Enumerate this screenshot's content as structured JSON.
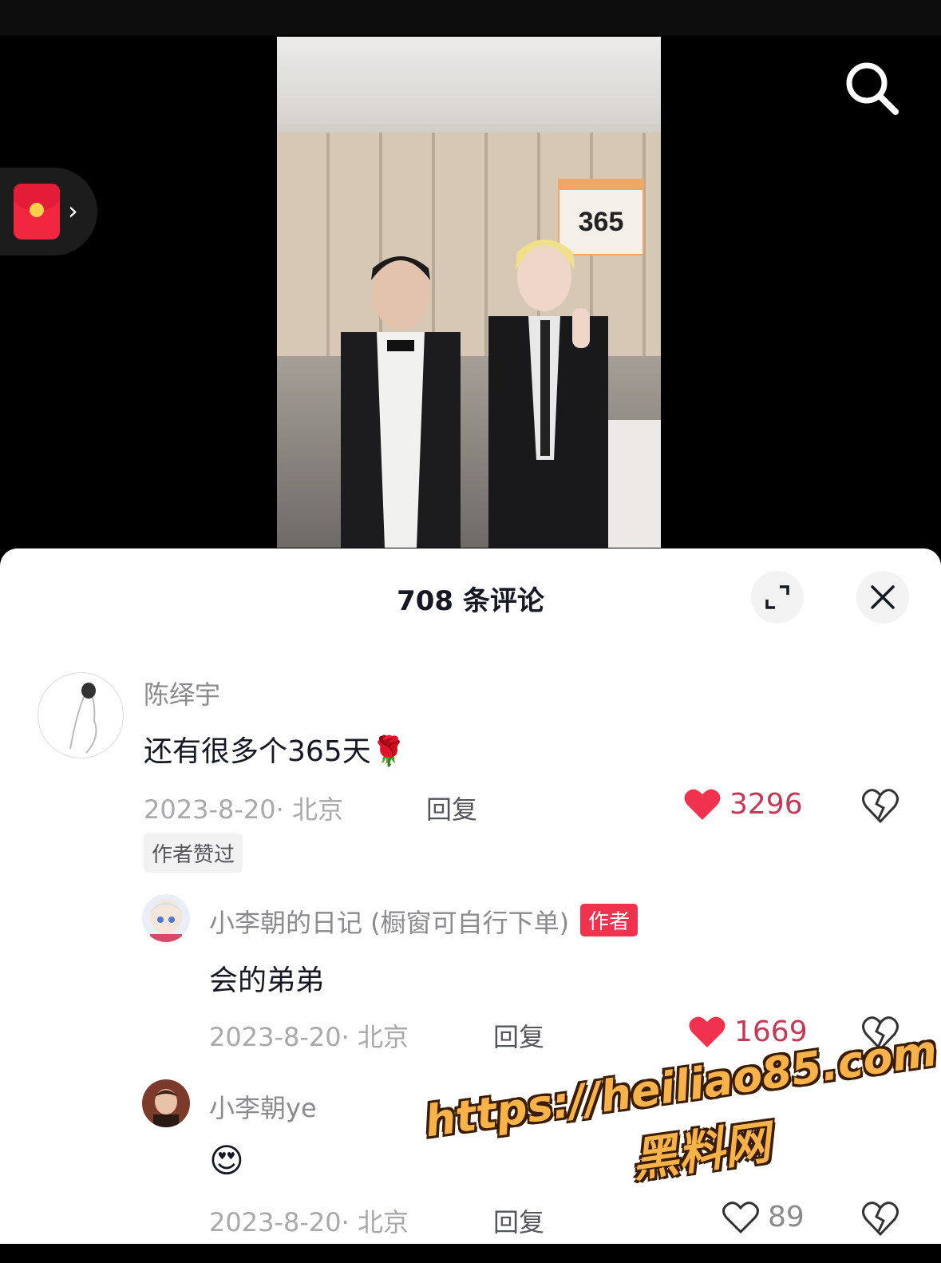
{
  "video": {
    "sign_number": "365"
  },
  "header_controls": {
    "search_icon": "search-icon",
    "red_packet_icon": "red-envelope-icon",
    "chevron": "›"
  },
  "comments_sheet": {
    "title": "708 条评论",
    "expand_icon": "expand-icon",
    "close_icon": "close-icon",
    "comments": [
      {
        "username": "陈绎宇",
        "text": "还有很多个365天",
        "emoji": "🌹",
        "date": "2023-8-20· 北京",
        "reply_label": "回复",
        "likes": "3296",
        "liked": true,
        "tag": "作者赞过"
      },
      {
        "username": "小李朝的日记 (橱窗可自行下单)",
        "badge": "作者",
        "text": "会的弟弟",
        "date": "2023-8-20· 北京",
        "reply_label": "回复",
        "likes": "1669",
        "liked": true
      },
      {
        "username": "小李朝ye",
        "text": "😍",
        "date": "2023-8-20· 北京",
        "reply_label": "回复",
        "likes": "89",
        "liked": false
      }
    ]
  },
  "watermark": {
    "url": "https://heiliao85.com",
    "name": "黑料网"
  },
  "colors": {
    "like_red": "#f1324f",
    "badge_red": "#f1324f",
    "watermark_orange": "#f7b24a"
  }
}
